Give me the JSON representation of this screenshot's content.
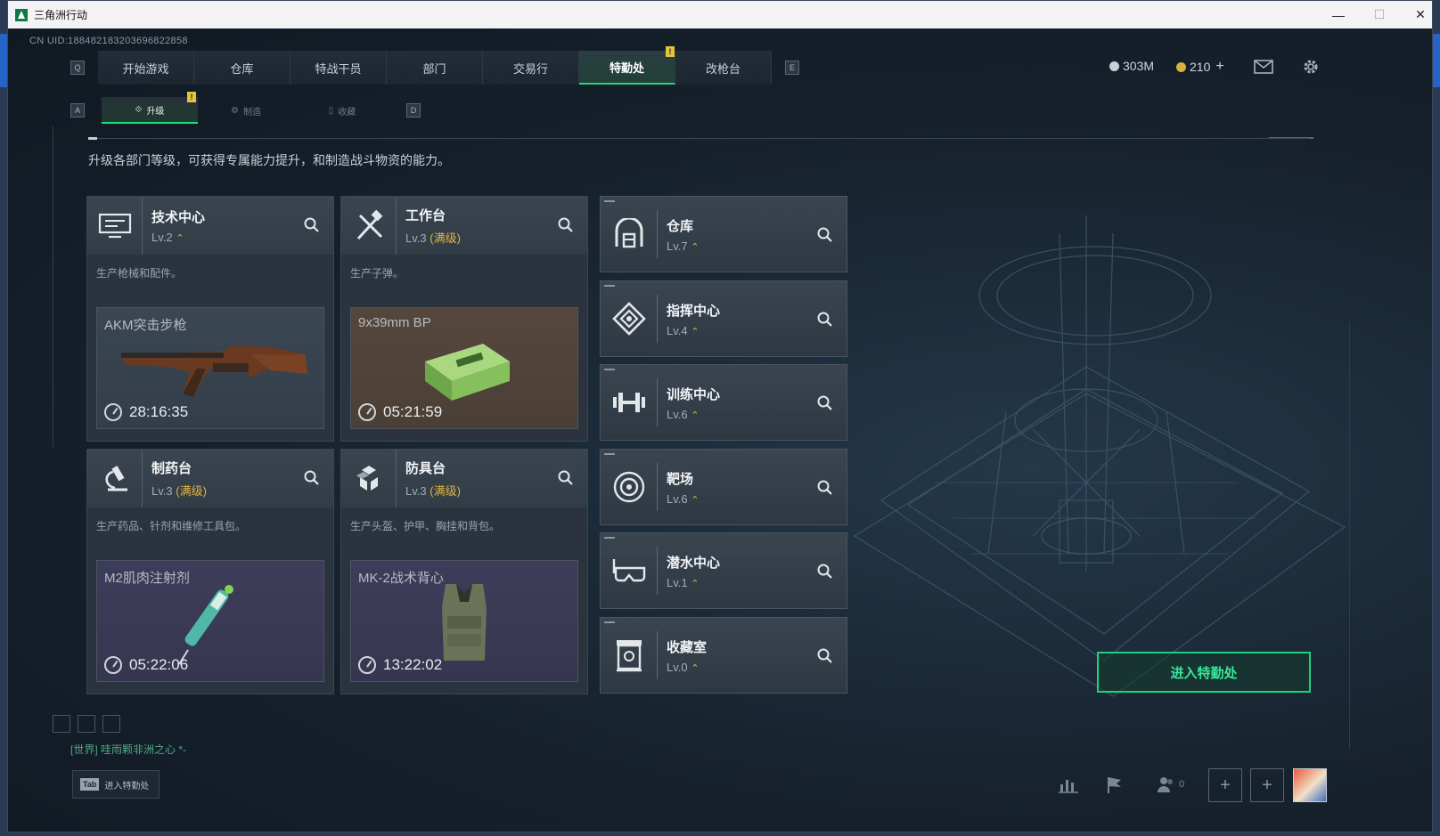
{
  "window": {
    "title": "三角洲行动",
    "minimize": "—",
    "maximize": "☐",
    "close": "✕"
  },
  "uid": "CN UID:1884821832036968​22858",
  "nav": {
    "left_key": "Q",
    "right_key": "E",
    "tabs": [
      {
        "label": "开始游戏"
      },
      {
        "label": "仓库"
      },
      {
        "label": "特战干员"
      },
      {
        "label": "部门"
      },
      {
        "label": "交易行"
      },
      {
        "label": "特勤处",
        "active": true,
        "badge": "!"
      },
      {
        "label": "改枪台"
      }
    ]
  },
  "currency": {
    "silver": "303M",
    "gold": "210",
    "gold_add": "+"
  },
  "subnav": {
    "left_key": "A",
    "right_key": "D",
    "tabs": [
      {
        "label": "升级",
        "active": true,
        "badge": "!"
      },
      {
        "label": "制造"
      },
      {
        "label": "收藏"
      }
    ]
  },
  "description": "升级各部门等级，可获得专属能力提升，和制造战斗物资的能力。",
  "workstations": [
    {
      "name": "技术中心",
      "level": "Lv.2",
      "max": "",
      "desc": "生产枪械和配件。",
      "item": "AKM突击步枪",
      "timer": "28:16:35",
      "icon": "monitor-icon"
    },
    {
      "name": "工作台",
      "level": "Lv.3",
      "max": "(满级)",
      "desc": "生产子弹。",
      "item": "9x39mm BP",
      "timer": "05:21:59",
      "icon": "tools-icon"
    },
    {
      "name": "制药台",
      "level": "Lv.3",
      "max": "(满级)",
      "desc": "生产药品、针剂和维修工具包。",
      "item": "M2肌肉注射剂",
      "timer": "05:22:06",
      "icon": "microscope-icon"
    },
    {
      "name": "防具台",
      "level": "Lv.3",
      "max": "(满级)",
      "desc": "生产头盔、护甲、胸挂和背包。",
      "item": "MK-2战术背心",
      "timer": "13:22:02",
      "icon": "armor-icon"
    }
  ],
  "facilities": [
    {
      "name": "仓库",
      "level": "Lv.7",
      "icon": "warehouse-icon"
    },
    {
      "name": "指挥中心",
      "level": "Lv.4",
      "icon": "command-icon"
    },
    {
      "name": "训练中心",
      "level": "Lv.6",
      "icon": "dumbbell-icon"
    },
    {
      "name": "靶场",
      "level": "Lv.6",
      "icon": "target-icon"
    },
    {
      "name": "潜水中心",
      "level": "Lv.1",
      "icon": "diving-mask-icon"
    },
    {
      "name": "收藏室",
      "level": "Lv.0",
      "icon": "collection-icon"
    }
  ],
  "enter_button": "进入特勤处",
  "chat": "[世界] 哇雨颗非洲之心 *-",
  "tab_hint": {
    "key": "Tab",
    "label": "进入特勤处"
  },
  "friends_count": "0",
  "colors": {
    "accent": "#21d583",
    "badge": "#e6c33a",
    "level_up": "#e2b53f"
  }
}
